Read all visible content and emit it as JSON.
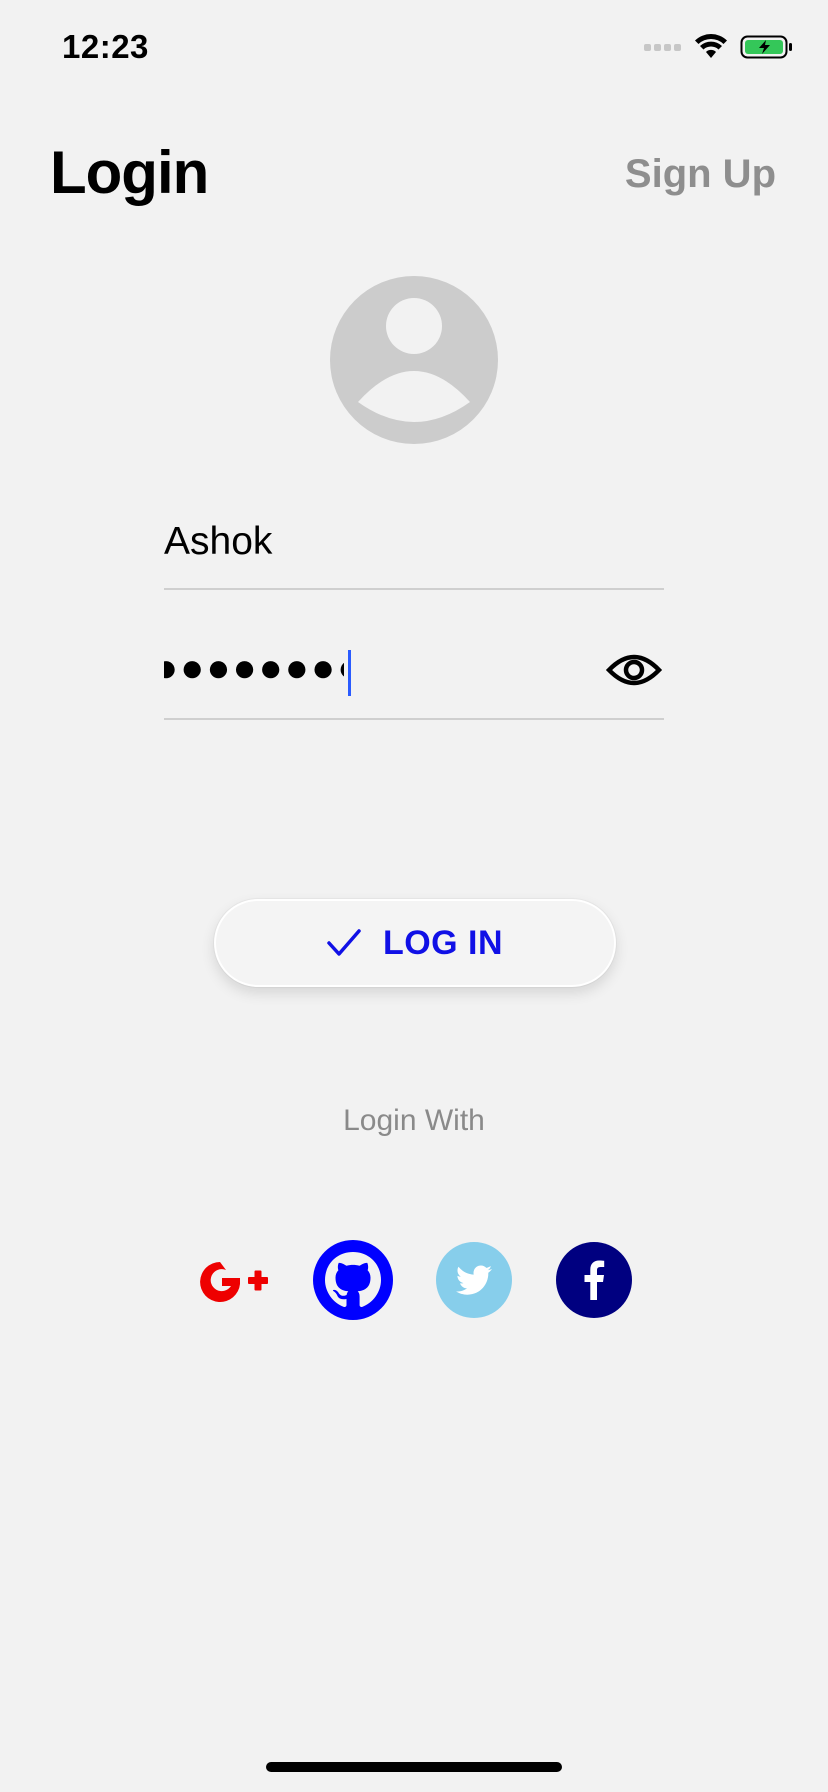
{
  "status_bar": {
    "time": "12:23"
  },
  "header": {
    "title": "Login",
    "signup_label": "Sign Up"
  },
  "form": {
    "username_value": "Ashok",
    "password_mask": "●●●●●●●●"
  },
  "login_button": {
    "label": "LOG IN"
  },
  "login_with_label": "Login With",
  "social": [
    {
      "name": "google-plus-icon",
      "color": "#ee0000"
    },
    {
      "name": "github-icon",
      "color": "#0000ff"
    },
    {
      "name": "twitter-icon",
      "color": "#87ceeb"
    },
    {
      "name": "facebook-icon",
      "color": "#000080"
    }
  ],
  "colors": {
    "accent": "#1010e6",
    "background": "#f2f2f2",
    "muted_text": "#8e8e8e",
    "battery_fill": "#34c759"
  }
}
